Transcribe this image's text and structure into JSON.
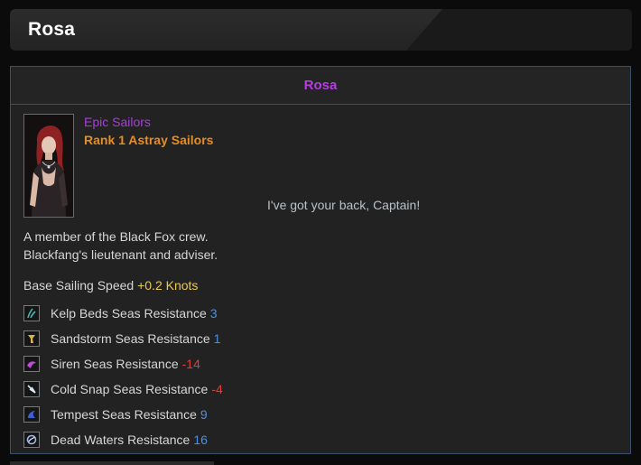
{
  "window": {
    "title": "Rosa"
  },
  "character": {
    "name": "Rosa",
    "grade": "Epic Sailors",
    "rank": "Rank 1 Astray Sailors",
    "quote": "I've got your back, Captain!",
    "description_line1": "A member of the Black Fox crew.",
    "description_line2": "Blackfang's lieutenant and adviser.",
    "speed_label": "Base Sailing Speed",
    "speed_value": "+0.2 Knots"
  },
  "resistances": [
    {
      "icon": "kelp-beds-icon",
      "label": "Kelp Beds Seas Resistance",
      "value": "3",
      "sign": "pos"
    },
    {
      "icon": "sandstorm-icon",
      "label": "Sandstorm Seas Resistance",
      "value": "1",
      "sign": "pos"
    },
    {
      "icon": "siren-icon",
      "label": "Siren Seas Resistance",
      "value": "-14",
      "sign": "neg"
    },
    {
      "icon": "cold-snap-icon",
      "label": "Cold Snap Seas Resistance",
      "value": "-4",
      "sign": "neg"
    },
    {
      "icon": "tempest-icon",
      "label": "Tempest Seas Resistance",
      "value": "9",
      "sign": "pos"
    },
    {
      "icon": "dead-waters-icon",
      "label": "Dead Waters Resistance",
      "value": "16",
      "sign": "pos"
    }
  ],
  "colors": {
    "grade": "#a93ddb",
    "rank": "#e58d26",
    "positive": "#4f8fe0",
    "negative": "#e33a3a",
    "speed": "#e8c95a",
    "panel_border": "#3b4f6a"
  }
}
